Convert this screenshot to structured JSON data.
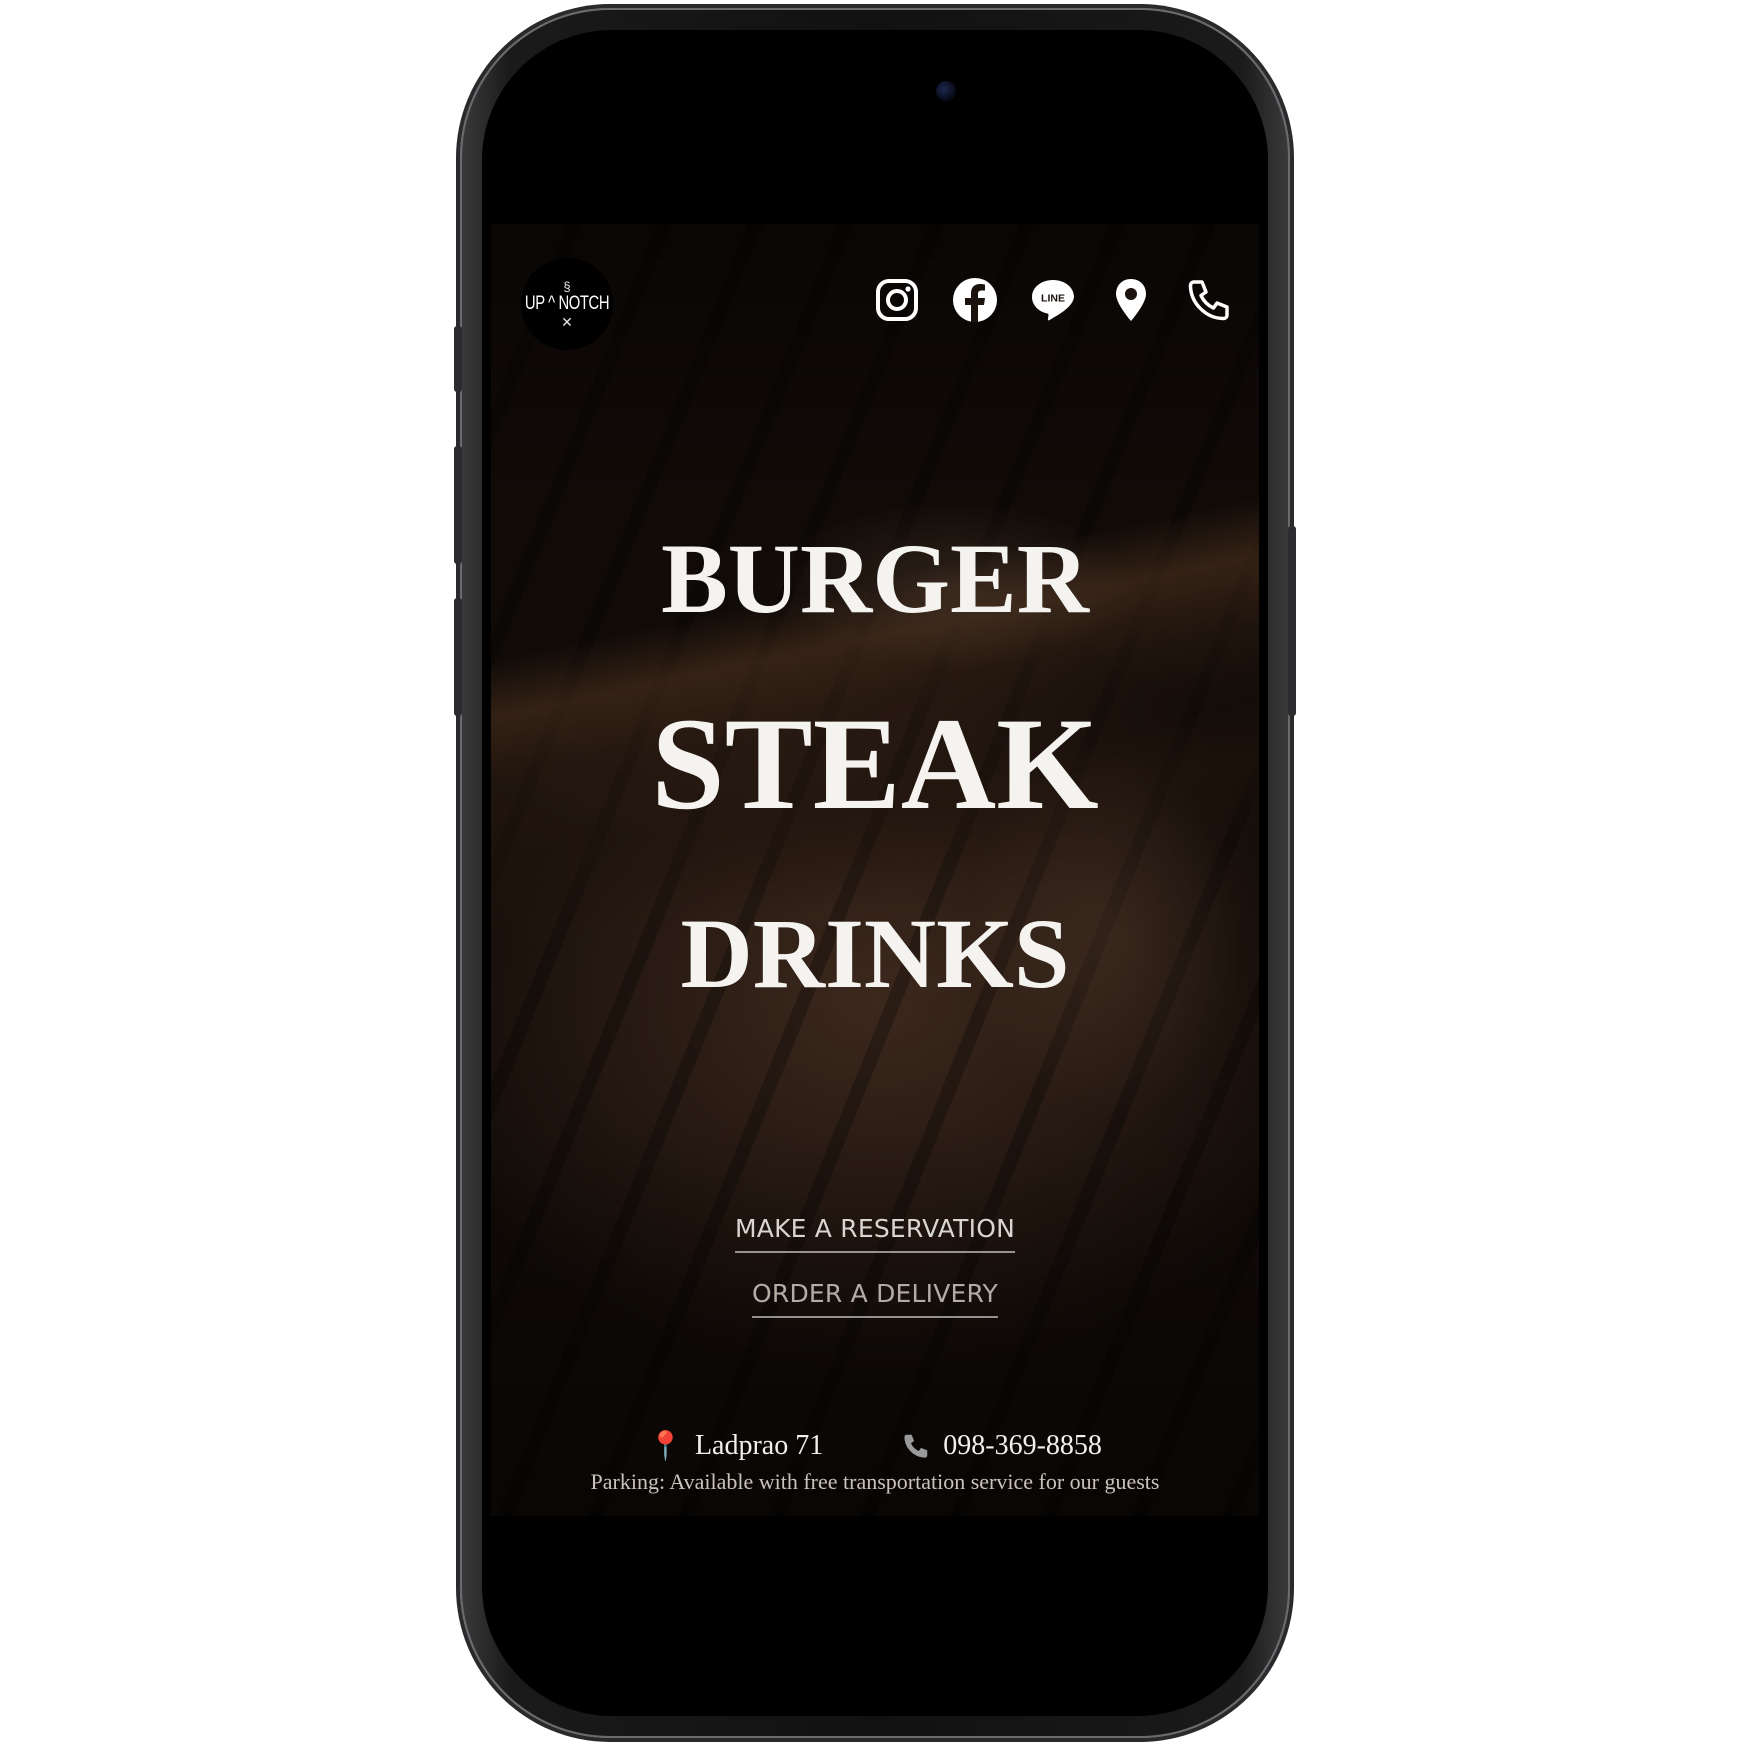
{
  "brand": {
    "logo_text": "UP ^ NOTCH"
  },
  "social": [
    "instagram-icon",
    "facebook-icon",
    "line-icon",
    "map-pin-icon",
    "phone-icon"
  ],
  "social_labels": {
    "line": "LINE"
  },
  "hero": {
    "line1": "BURGER",
    "line2": "STEAK",
    "line3": "DRINKS"
  },
  "actions": {
    "reservation": "MAKE A RESERVATION",
    "delivery": "ORDER A DELIVERY"
  },
  "contact": {
    "location": "Ladprao 71",
    "phone": "098-369-8858",
    "parking": "Parking: Available with free transportation service for our guests"
  },
  "colors": {
    "text": "#f5f3f0",
    "pin": "#e23b3b",
    "background": "#120b08"
  }
}
